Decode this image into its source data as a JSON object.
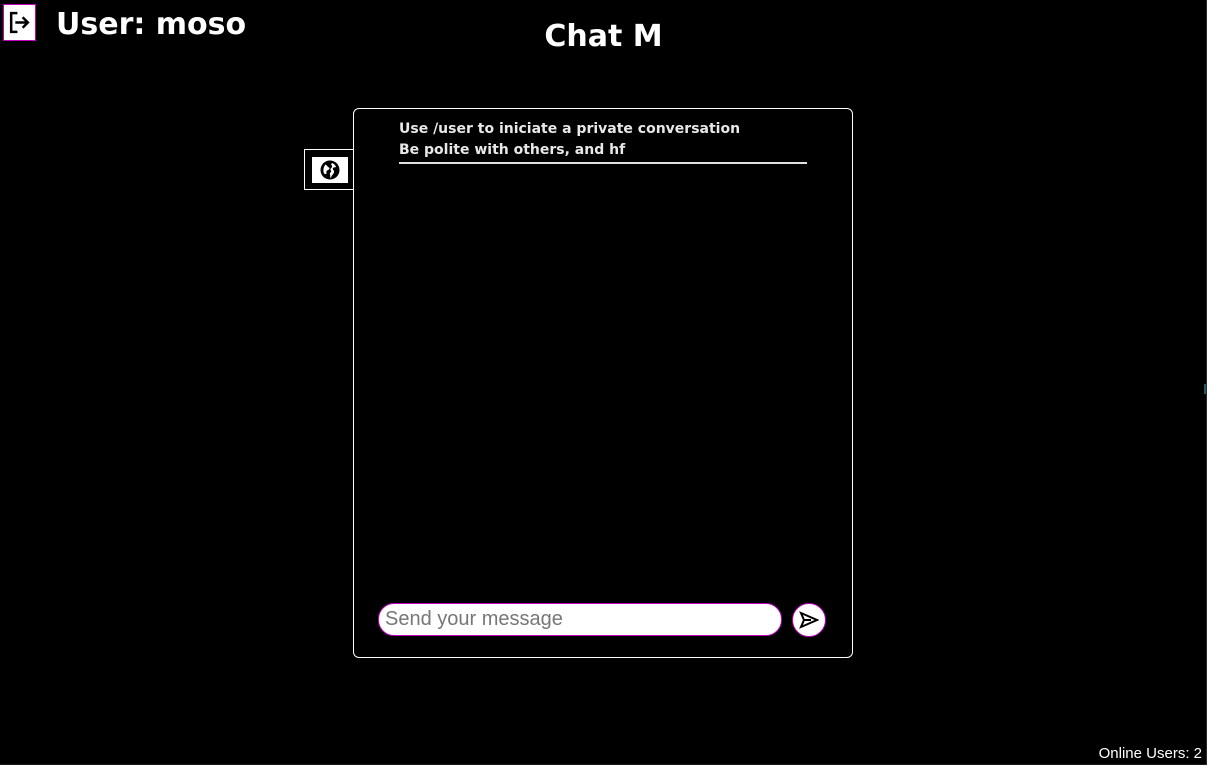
{
  "header": {
    "logout_icon": "logout-arrow-icon",
    "user_label": "User: moso",
    "app_title": "Chat M"
  },
  "rooms": {
    "active_icon": "globe-icon"
  },
  "chat": {
    "notice_lines": [
      "Use /user to iniciate a private conversation",
      "Be polite with others, and hf"
    ],
    "messages": [],
    "input_placeholder": "Send your message",
    "input_value": "",
    "send_icon": "send-icon"
  },
  "footer": {
    "online_users": "Online Users: 2"
  },
  "colors": {
    "background": "#000000",
    "text": "#ffffff",
    "accent_border": "#c000c0"
  }
}
